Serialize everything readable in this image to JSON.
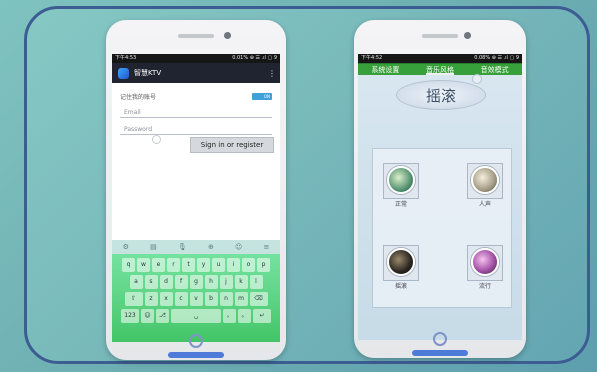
{
  "phone1": {
    "status": {
      "time": "下午4:53",
      "right": "0.01% ⊕ ☰ .ıl ▢ 9"
    },
    "app": {
      "title": "智慧KTV",
      "overflow": "⋮"
    },
    "form": {
      "remember_label": "记住我的账号",
      "toggle_label": "ON",
      "email_placeholder": "Email",
      "password_placeholder": "Password",
      "signin_label": "Sign in or register"
    },
    "keyboard": {
      "toolbar": [
        "⚙",
        "▤",
        "🎙",
        "⊕",
        "☺",
        "≡"
      ],
      "rows": [
        [
          "q",
          "w",
          "e",
          "r",
          "t",
          "y",
          "u",
          "i",
          "o",
          "p"
        ],
        [
          "a",
          "s",
          "d",
          "f",
          "g",
          "h",
          "j",
          "k",
          "l"
        ],
        [
          "⇧",
          "z",
          "x",
          "c",
          "v",
          "b",
          "n",
          "m",
          "⌫"
        ],
        [
          "123",
          "☺",
          "⎇",
          "␣",
          "，",
          "。",
          "↵"
        ]
      ]
    }
  },
  "phone2": {
    "status": {
      "time": "下午4:52",
      "right": "0.08% ⊕ ☰ .ıl ▢ 9"
    },
    "tabs": [
      {
        "label": "系统设置",
        "active": false
      },
      {
        "label": "音乐风格",
        "active": true
      },
      {
        "label": "音效模式",
        "active": false
      }
    ],
    "style_title": "摇滚",
    "options": [
      {
        "label": "正常",
        "icon": "landscape-thumbnail"
      },
      {
        "label": "人声",
        "icon": "crowd-thumbnail"
      },
      {
        "label": "摇滚",
        "icon": "rock-thumbnail"
      },
      {
        "label": "流行",
        "icon": "pop-thumbnail"
      }
    ]
  }
}
